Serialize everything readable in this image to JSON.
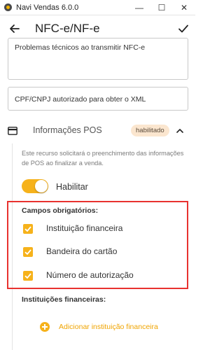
{
  "window": {
    "title": "Navi Vendas 6.0.0",
    "controls": {
      "minimize": "—",
      "maximize": "☐",
      "close": "✕"
    }
  },
  "appbar": {
    "title": "NFC-e/NF-e",
    "back_icon": "arrow-left-icon",
    "confirm_icon": "check-icon"
  },
  "fields": {
    "reason_value": "Problemas técnicos ao transmitir NFC-e",
    "cpf_cnpj_placeholder": "CPF/CNPJ autorizado para obter o XML"
  },
  "pos_section": {
    "icon": "credit-card-icon",
    "title": "Informações POS",
    "badge": "habilitado",
    "description": "Este recurso solicitará o preenchimento das informações de POS ao finalizar a venda.",
    "toggle_label": "Habilitar",
    "toggle_on": true,
    "required_title": "Campos obrigatórios:",
    "required_fields": [
      {
        "label": "Instituição financeira",
        "checked": true
      },
      {
        "label": "Bandeira do cartão",
        "checked": true
      },
      {
        "label": "Número de autorização",
        "checked": true
      }
    ],
    "institutions_title": "Instituições financeiras:",
    "add_button_label": "Adicionar instituição financeira"
  },
  "colors": {
    "accent": "#f6b21b",
    "badge_bg": "#fbe6cf",
    "highlight_border": "#e8322f"
  }
}
